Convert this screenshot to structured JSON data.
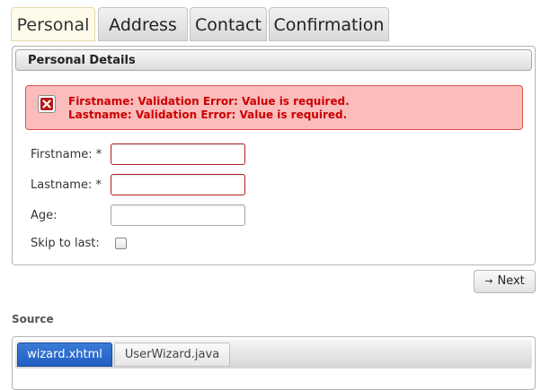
{
  "wizard": {
    "steps": [
      {
        "label": "Personal",
        "active": true
      },
      {
        "label": "Address",
        "active": false
      },
      {
        "label": "Contact",
        "active": false
      },
      {
        "label": "Confirmation",
        "active": false
      }
    ]
  },
  "panel": {
    "title": "Personal Details",
    "errors": [
      "Firstname: Validation Error: Value is required.",
      "Lastname: Validation Error: Value is required."
    ],
    "fields": {
      "firstname": {
        "label": "Firstname: *",
        "value": ""
      },
      "lastname": {
        "label": "Lastname: *",
        "value": ""
      },
      "age": {
        "label": "Age:",
        "value": ""
      },
      "skip": {
        "label": "Skip to last:",
        "checked": false
      }
    }
  },
  "next_button": {
    "label": "Next",
    "icon": "arrow-right-icon"
  },
  "source": {
    "title": "Source",
    "tabs": [
      {
        "label": "wizard.xhtml",
        "active": true
      },
      {
        "label": "UserWizard.java",
        "active": false
      }
    ]
  },
  "colors": {
    "error_text": "#cc0000",
    "error_background": "#fbbcbc",
    "active_source_tab": "#1f5fc4",
    "active_step_background": "#fffbea"
  }
}
